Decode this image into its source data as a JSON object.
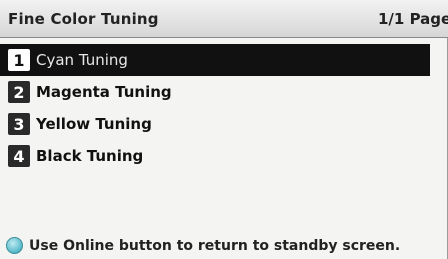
{
  "header": {
    "title": "Fine Color Tuning",
    "page_indicator": "1/1 Page"
  },
  "menu": {
    "items": [
      {
        "number": "1",
        "label": "Cyan Tuning",
        "selected": true
      },
      {
        "number": "2",
        "label": "Magenta Tuning",
        "selected": false
      },
      {
        "number": "3",
        "label": "Yellow Tuning",
        "selected": false
      },
      {
        "number": "4",
        "label": "Black Tuning",
        "selected": false
      }
    ]
  },
  "status": {
    "icon": "online-button-icon",
    "message": "Use Online button to return to standby screen."
  },
  "colors": {
    "selected_background": "#111111",
    "online_icon": "#55b9c9"
  }
}
